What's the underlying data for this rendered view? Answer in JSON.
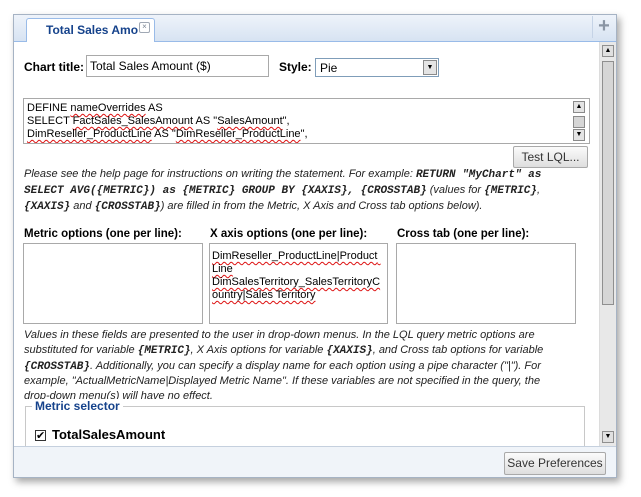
{
  "tab": {
    "title": "Total Sales Amo",
    "close_glyph": "×"
  },
  "toolbar": {
    "add_glyph": "+"
  },
  "form": {
    "chart_title_label": "Chart title:",
    "chart_title_value": "Total Sales Amount ($)",
    "style_label": "Style:",
    "style_value": "Pie",
    "lql_lines": [
      [
        "DEFINE ",
        "nameOverrides",
        " AS"
      ],
      [
        "SELECT ",
        "FactSales_SalesAmount",
        " AS \"",
        "SalesAmount",
        "\","
      ],
      [
        "DimReseller_ProductLine",
        " AS \"",
        "DimReseller_ProductLine",
        "\","
      ]
    ],
    "test_button": "Test LQL...",
    "help_text": {
      "l1a": "Please see the help page for instructions on writing the statement. For example: ",
      "l1b": "RETURN \"MyChart\" as",
      "l2a": "SELECT AVG({METRIC}) as {METRIC} GROUP BY {XAXIS}, {CROSSTAB}",
      "l2b": " (values for ",
      "l2c": "{METRIC}",
      "l2d": ",",
      "l3a": "{XAXIS}",
      "l3b": " and ",
      "l3c": "{CROSSTAB}",
      "l3d": ") are filled in from the Metric, X Axis and Cross tab options below)."
    },
    "metric_options_label": "Metric options (one per line):",
    "xaxis_options_label": "X axis options (one per line):",
    "crosstab_options_label": "Cross tab (one per line):",
    "metric_options_value": "",
    "xaxis_options_value": "DimReseller_ProductLine|Product Line\nDimSalesTerritory_SalesTerritoryCountry|Sales Territory",
    "crosstab_options_value": "",
    "notes_text": {
      "l1": "Values in these fields are presented to the user in drop-down menus. In the LQL query metric options are",
      "l2a": "substituted for variable ",
      "l2b": "{METRIC}",
      "l2c": ", X Axis options for variable ",
      "l2d": "{XAXIS}",
      "l2e": ", and Cross tab options for variable",
      "l3a": "{CROSSTAB}",
      "l3b": ". Additionally, you can specify a display name for each option using a pipe character (\"|\"). For",
      "l4": "example, \"ActualMetricName|Displayed Metric Name\". If these variables are not specified in the query, the",
      "l5": "drop-down menu(s) will have no effect."
    },
    "metric_selector_legend": "Metric selector",
    "metric_checkbox_label": "TotalSalesAmount",
    "metric_checked": true
  },
  "footer": {
    "save_button": "Save Preferences"
  }
}
